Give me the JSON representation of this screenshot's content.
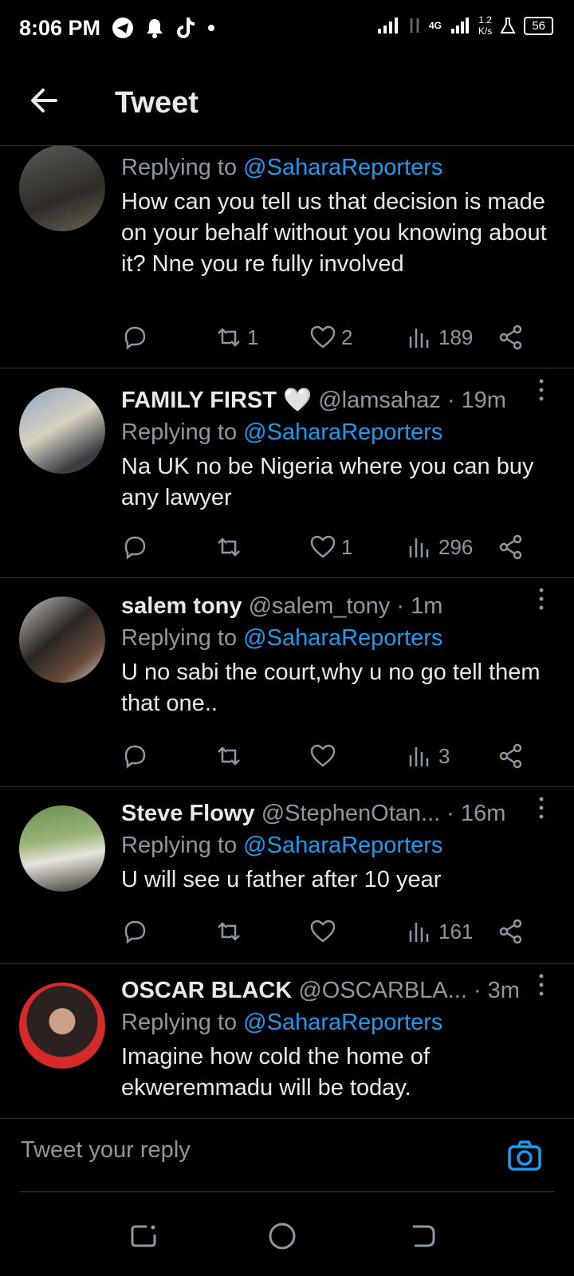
{
  "status_bar": {
    "time": "8:06 PM",
    "network": "4G",
    "speed_value": "1.2",
    "speed_unit": "K/s",
    "battery": "56"
  },
  "header": {
    "title": "Tweet"
  },
  "tweets": [
    {
      "name": "",
      "handle": "",
      "time": "",
      "replying_to_label": "Replying to",
      "replying_to": "@SaharaReporters",
      "text": "How can you tell us that decision is made on your behalf without you knowing about it? Nne you re fully involved",
      "retweets": "1",
      "likes": "2",
      "views": "189"
    },
    {
      "name": "FAMILY FIRST 🤍",
      "handle": "@lamsahaz",
      "time": "· 19m",
      "replying_to_label": "Replying to",
      "replying_to": "@SaharaReporters",
      "text": "Na UK no be Nigeria where you can buy any lawyer",
      "retweets": "",
      "likes": "1",
      "views": "296"
    },
    {
      "name": "salem tony",
      "handle": "@salem_tony",
      "time": "· 1m",
      "replying_to_label": "Replying to",
      "replying_to": "@SaharaReporters",
      "text": "U no sabi the court,why u no go tell them that one..",
      "retweets": "",
      "likes": "",
      "views": "3"
    },
    {
      "name": "Steve Flowy",
      "handle": "@StephenOtan...",
      "time": "· 16m",
      "replying_to_label": "Replying to",
      "replying_to": "@SaharaReporters",
      "text": "U will see u father after 10 year",
      "retweets": "",
      "likes": "",
      "views": "161"
    },
    {
      "name": "OSCAR BLACK",
      "handle": "@OSCARBLA...",
      "time": "· 3m",
      "replying_to_label": "Replying to",
      "replying_to": "@SaharaReporters",
      "text": "Imagine  how cold the home of ekweremmadu  will be today.",
      "retweets": "",
      "likes": "",
      "views": ""
    }
  ],
  "reply_box": {
    "placeholder": "Tweet your reply"
  },
  "colors": {
    "accent": "#1d9bf0",
    "muted": "#8b98a5",
    "background": "#000000"
  }
}
